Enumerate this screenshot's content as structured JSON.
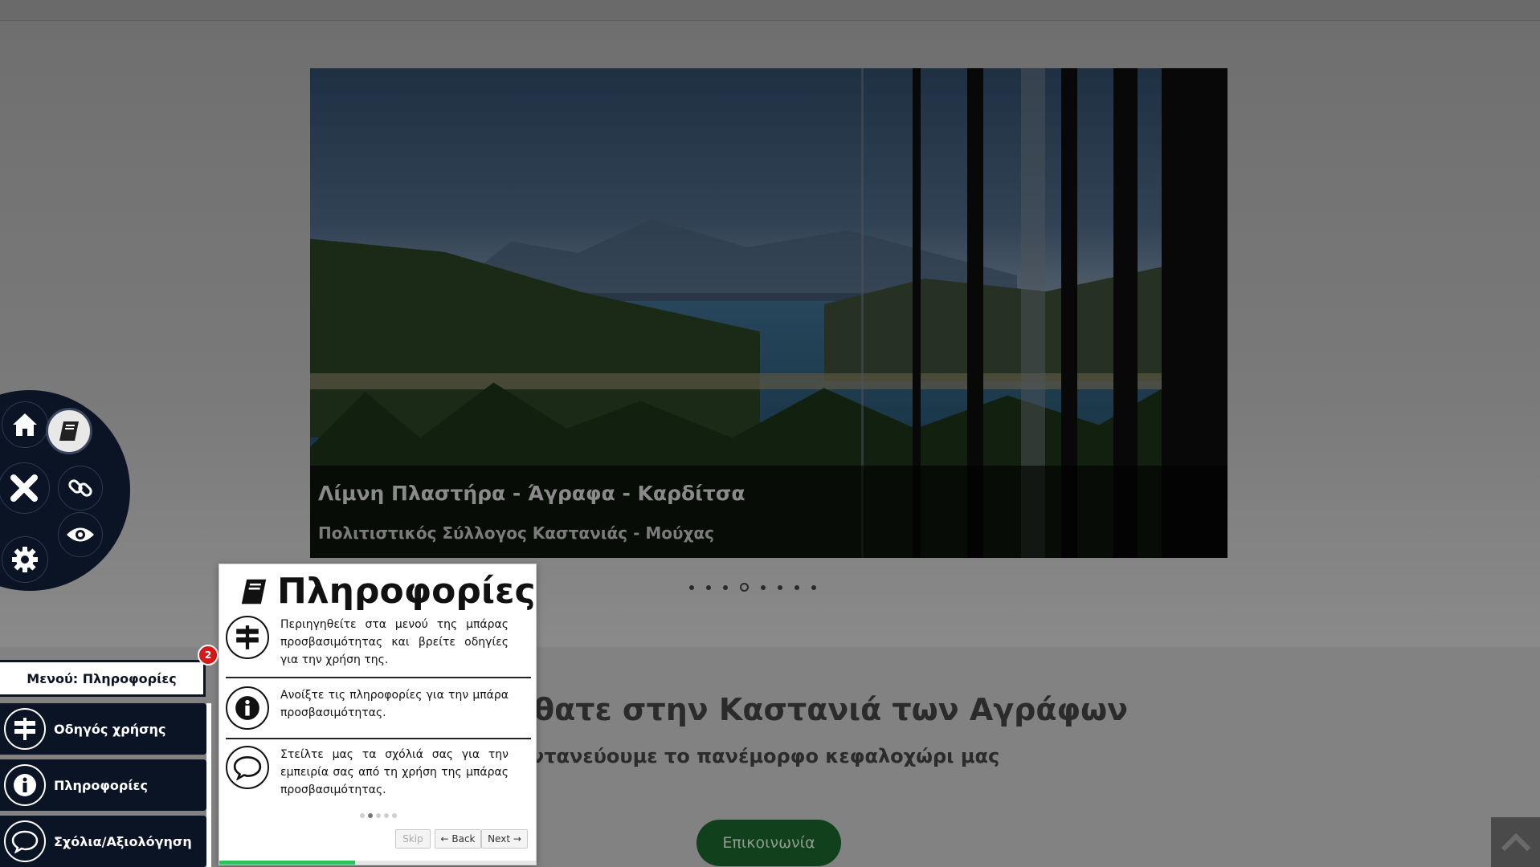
{
  "slider": {
    "caption_title": "Λίμνη Πλαστήρα - Άγραφα - Καρδίτσα",
    "caption_subtitle": "Πολιτιστικός Σύλλογος Καστανιάς - Μούχας",
    "slide_count": 8,
    "active_slide": 4
  },
  "welcome": {
    "title": "λθατε στην Καστανιά των Αγράφων",
    "subtitle": "ωντανεύουμε το πανέμορφο κεφαλοχώρι μας",
    "contact_label": "Επικοινωνία"
  },
  "radial_menu": {
    "items": [
      {
        "icon": "home-icon"
      },
      {
        "icon": "book-icon",
        "selected": true
      },
      {
        "icon": "close-icon"
      },
      {
        "icon": "link-icon"
      },
      {
        "icon": "eye-icon"
      },
      {
        "icon": "gear-icon"
      }
    ]
  },
  "access_panel": {
    "menu_label": "Μενού: Πληροφορίες",
    "badge": "2",
    "items": [
      {
        "label": "Οδηγός χρήσης",
        "icon": "signpost-icon"
      },
      {
        "label": "Πληροφορίες",
        "icon": "info-icon"
      },
      {
        "label": "Σχόλια/Αξιολόγηση",
        "icon": "comment-icon"
      }
    ]
  },
  "tour": {
    "title": "Πληροφορίες",
    "rows": [
      {
        "icon": "signpost-icon",
        "text": "Περιηγηθείτε στα μενού της μπάρας προσβασιμότητας και βρείτε οδηγίες για την χρήση της."
      },
      {
        "icon": "info-icon",
        "text": "Ανοίξτε τις πληροφορίες για την μπάρα προσβασιμότητας."
      },
      {
        "icon": "comment-icon",
        "text": "Στείλτε μας τα σχόλιά σας για την εμπειρία σας από τη χρήση της μπάρας προσβασιμότητας."
      }
    ],
    "step_count": 5,
    "active_step": 2,
    "progress": 0.43,
    "skip_label": "Skip",
    "back_label": "← Back",
    "next_label": "Next →"
  }
}
